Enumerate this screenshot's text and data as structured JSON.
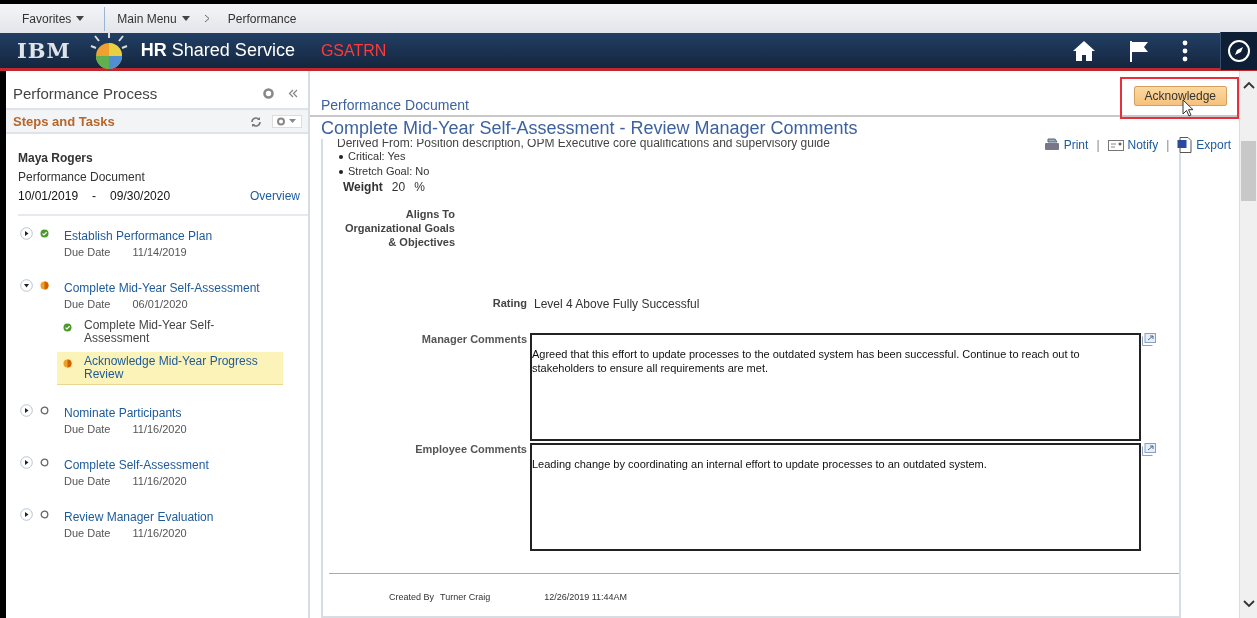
{
  "nav": {
    "items": [
      {
        "label": "Favorites",
        "dropdown": true
      },
      {
        "label": "Main Menu",
        "dropdown": true
      },
      {
        "label": "Performance",
        "dropdown": false
      }
    ]
  },
  "header": {
    "logo": "IBM",
    "title": "**HR** Shared Service",
    "environment": "GSATRN"
  },
  "sidebar": {
    "title": "Performance Process",
    "section": "Steps and Tasks",
    "employee": "Maya Rogers",
    "document": "Performance Document",
    "start_date": "10/01/2019",
    "separator": "-",
    "end_date": "09/30/2020",
    "overview_link": "Overview",
    "steps": [
      {
        "name": "Establish Performance Plan",
        "kind": "complete",
        "expanded": false,
        "due_label": "Due Date",
        "due_date": "11/14/2019"
      },
      {
        "name": "Complete Mid-Year Self-Assessment",
        "kind": "inprogress",
        "expanded": true,
        "due_label": "Due Date",
        "due_date": "06/01/2020",
        "children": [
          {
            "name": "Complete Mid-Year Self-Assessment",
            "kind": "complete",
            "selected": false
          },
          {
            "name": "Acknowledge Mid-Year Progress Review",
            "kind": "inprogress",
            "selected": true
          }
        ]
      },
      {
        "name": "Nominate Participants",
        "kind": "pending",
        "expanded": false,
        "due_label": "Due Date",
        "due_date": "11/16/2020"
      },
      {
        "name": "Complete Self-Assessment",
        "kind": "pending",
        "expanded": false,
        "due_label": "Due Date",
        "due_date": "11/16/2020"
      },
      {
        "name": "Review Manager Evaluation",
        "kind": "pending",
        "expanded": false,
        "due_label": "Due Date",
        "due_date": "11/16/2020"
      }
    ]
  },
  "document": {
    "section": "Performance Document",
    "title": "Complete Mid-Year Self-Assessment - Review Manager Comments",
    "acknowledge_button": "Acknowledge",
    "highlighted": true,
    "action_separator": "|",
    "actions": [
      {
        "label": "Print",
        "kind": "print"
      },
      {
        "label": "Notify",
        "kind": "notify"
      },
      {
        "label": "Export",
        "kind": "export"
      }
    ],
    "derived_from": "Derived From: Position description, OPM Executive core qualifications and supervisory guide",
    "bullets": [
      "Critical: Yes",
      "Stretch Goal: No"
    ],
    "weight": {
      "label": "Weight",
      "value": "20",
      "unit": "%"
    },
    "aligns_label": "Aligns To Organizational Goals & Objectives",
    "rating": {
      "label": "Rating",
      "value": "Level 4 Above Fully Successful"
    },
    "comments": [
      {
        "label": "Manager Comments",
        "text": "Agreed that this effort to update processes to the outdated system has been successful. Continue to reach out to stakeholders to ensure all requirements are met."
      },
      {
        "label": "Employee Comments",
        "text": "Leading change by coordinating an internal effort to update processes to an outdated system."
      }
    ],
    "footer": {
      "created_label": "Created By",
      "created_by": "Turner Craig",
      "created_at": "12/26/2019 11:44AM"
    }
  }
}
